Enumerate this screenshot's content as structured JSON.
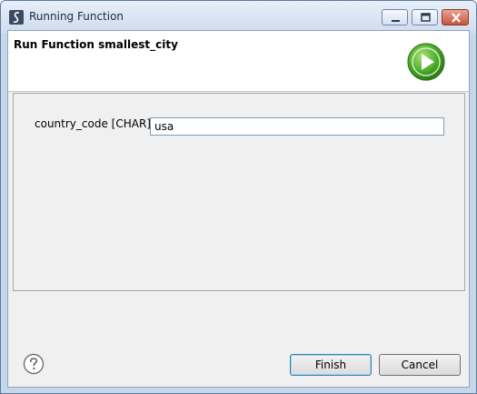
{
  "window": {
    "title": "Running Function",
    "icons": {
      "app": "app-icon",
      "minimize": "minimize-icon",
      "maximize": "maximize-icon",
      "close": "close-icon"
    }
  },
  "banner": {
    "title": "Run Function smallest_city",
    "icon": "run-icon"
  },
  "form": {
    "fields": [
      {
        "label": "country_code [CHAR]",
        "value": "usa"
      }
    ]
  },
  "footer": {
    "help_icon": "help-icon",
    "finish_label": "Finish",
    "cancel_label": "Cancel"
  }
}
